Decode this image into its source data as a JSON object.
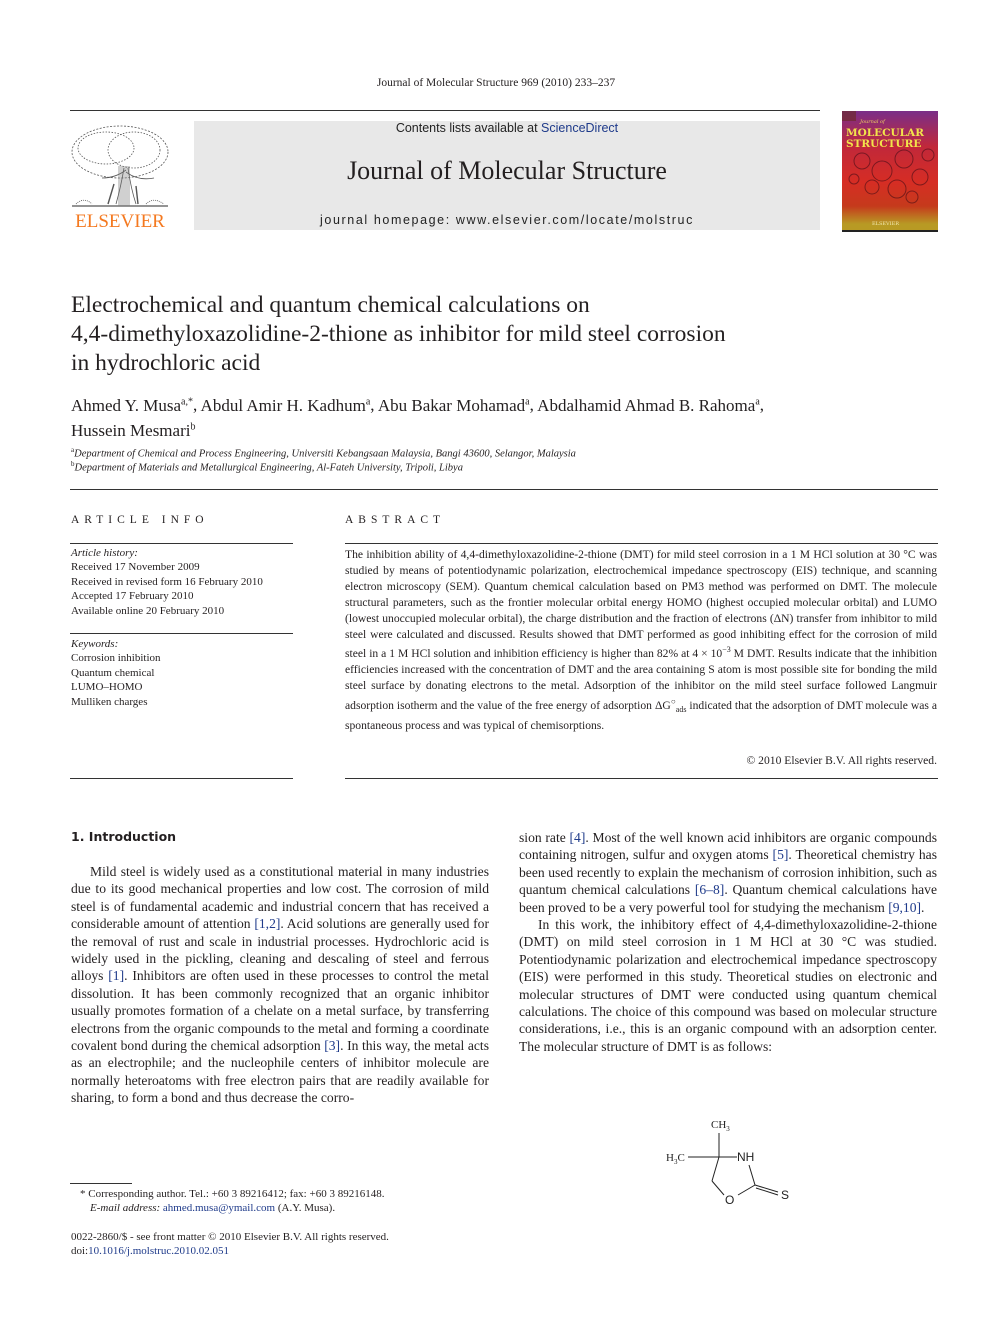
{
  "header": {
    "running_head": "Journal of Molecular Structure 969 (2010) 233–237",
    "publisher_logo_text": "ELSEVIER",
    "contents_prefix": "Contents lists available at ",
    "contents_link": "ScienceDirect",
    "journal_title": "Journal of Molecular Structure",
    "homepage": "journal homepage: www.elsevier.com/locate/molstruc",
    "cover": {
      "small_title": "Journal of",
      "title_line1": "MOLECULAR",
      "title_line2": "STRUCTURE",
      "publisher": "ELSEVIER"
    }
  },
  "article": {
    "title_lines": [
      "Electrochemical and quantum chemical calculations on",
      "4,4-dimethyloxazolidine-2-thione as inhibitor for mild steel corrosion",
      "in hydrochloric acid"
    ],
    "authors": [
      {
        "name": "Ahmed Y. Musa",
        "sup": "a,*",
        "sep": ", "
      },
      {
        "name": "Abdul Amir H. Kadhum",
        "sup": "a",
        "sep": ", "
      },
      {
        "name": "Abu Bakar Mohamad",
        "sup": "a",
        "sep": ", "
      },
      {
        "name": "Abdalhamid Ahmad B. Rahoma",
        "sup": "a",
        "sep": ","
      },
      {
        "name": "Hussein Mesmari",
        "sup": "b",
        "sep": ""
      }
    ],
    "affiliations": [
      {
        "sup": "a",
        "text": "Department of Chemical and Process Engineering, Universiti Kebangsaan Malaysia, Bangi 43600, Selangor, Malaysia"
      },
      {
        "sup": "b",
        "text": "Department of Materials and Metallurgical Engineering, Al-Fateh University, Tripoli, Libya"
      }
    ]
  },
  "article_info": {
    "heading": "ARTICLE INFO",
    "history_label": "Article history:",
    "history": [
      "Received 17 November 2009",
      "Received in revised form 16 February 2010",
      "Accepted 17 February 2010",
      "Available online 20 February 2010"
    ],
    "keywords_label": "Keywords:",
    "keywords": [
      "Corrosion inhibition",
      "Quantum chemical",
      "LUMO–HOMO",
      "Mulliken charges"
    ]
  },
  "abstract": {
    "heading": "ABSTRACT",
    "text_part1": "The inhibition ability of 4,4-dimethyloxazolidine-2-thione (DMT) for mild steel corrosion in a 1 M HCl solution at 30 °C was studied by means of potentiodynamic polarization, electrochemical impedance spectroscopy (EIS) technique, and scanning electron microscopy (SEM). Quantum chemical calculation based on PM3 method was performed on DMT. The molecule structural parameters, such as the frontier molecular orbital energy HOMO (highest occupied molecular orbital) and LUMO (lowest unoccupied molecular orbital), the charge distribution and the fraction of electrons (ΔN) transfer from inhibitor to mild steel were calculated and discussed. Results showed that DMT performed as good inhibiting effect for the corrosion of mild steel in a 1 M HCl solution and inhibition efficiency is higher than 82% at 4 × 10",
    "exponent": "−3",
    "text_part2": " M DMT. Results indicate that the inhibition efficiencies increased with the concentration of DMT and the area containing S atom is most possible site for bonding the mild steel surface by donating electrons to the metal. Adsorption of the inhibitor on the mild steel surface followed Langmuir adsorption isotherm and the value of the free energy of adsorption ΔG",
    "symbol_sup": "○",
    "symbol_sub": "ads",
    "text_part3": " indicated that the adsorption of DMT molecule was a spontaneous process and was typical of chemisorptions.",
    "copyright": "© 2010 Elsevier B.V. All rights reserved."
  },
  "introduction": {
    "heading": "1. Introduction",
    "col1": [
      {
        "t": "Mild steel is widely used as a constitutional material in many industries due to its good mechanical properties and low cost. The corrosion of mild steel is of fundamental academic and industrial concern that has received a considerable amount of attention "
      },
      {
        "ref": "[1,2]"
      },
      {
        "t": ". Acid solutions are generally used for the removal of rust and scale in industrial processes. Hydrochloric acid is widely used in the pickling, cleaning and descaling of steel and ferrous alloys "
      },
      {
        "ref": "[1]"
      },
      {
        "t": ". Inhibitors are often used in these processes to control the metal dissolution. It has been commonly recognized that an organic inhibitor usually promotes formation of a chelate on a metal surface, by transferring electrons from the organic compounds to the metal and forming a coordinate covalent bond during the chemical adsorption "
      },
      {
        "ref": "[3]"
      },
      {
        "t": ". In this way, the metal acts as an electrophile; and the nucleophile centers of inhibitor molecule are normally heteroatoms with free electron pairs that are readily available for sharing, to form a bond and thus decrease the corro-"
      }
    ],
    "col2_p1": [
      {
        "t": "sion rate "
      },
      {
        "ref": "[4]"
      },
      {
        "t": ". Most of the well known acid inhibitors are organic compounds containing nitrogen, sulfur and oxygen atoms "
      },
      {
        "ref": "[5]"
      },
      {
        "t": ". Theoretical chemistry has been used recently to explain the mechanism of corrosion inhibition, such as quantum chemical calculations "
      },
      {
        "ref": "[6–8]"
      },
      {
        "t": ". Quantum chemical calculations have been proved to be a very powerful tool for studying the mechanism "
      },
      {
        "ref": "[9,10]"
      },
      {
        "t": "."
      }
    ],
    "col2_p2": "In this work, the inhibitory effect of 4,4-dimethyloxazolidine-2-thione (DMT) on mild steel corrosion in 1 M HCl at 30 °C was studied. Potentiodynamic polarization and electrochemical impedance spectroscopy (EIS) were performed in this study. Theoretical studies on electronic and molecular structures of DMT were conducted using quantum chemical calculations. The choice of this compound was based on molecular structure considerations, i.e., this is an organic compound with an adsorption center. The molecular structure of DMT is as follows:"
  },
  "molecule": {
    "ch3_top": "CH",
    "ch3_top_sub": "3",
    "h3c_left": "H",
    "h3c_left_sub": "3",
    "h3c_left_tail": "C",
    "nh": "NH",
    "o": "O",
    "s": "S"
  },
  "footnotes": {
    "corresponding": "* Corresponding author. Tel.: +60 3 89216412; fax: +60 3 89216148.",
    "email_label": "E-mail address: ",
    "email": "ahmed.musa@ymail.com",
    "email_suffix": " (A.Y. Musa).",
    "front_matter": "0022-2860/$ - see front matter © 2010 Elsevier B.V. All rights reserved.",
    "doi_prefix": "doi:",
    "doi": "10.1016/j.molstruc.2010.02.051"
  }
}
